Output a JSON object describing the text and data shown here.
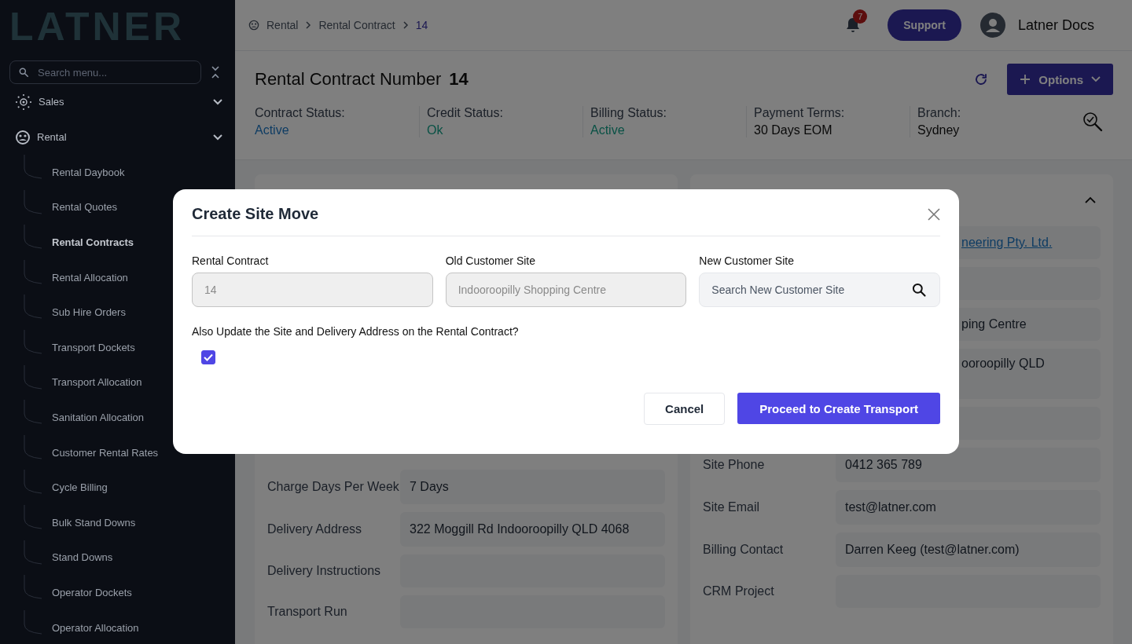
{
  "sidebar": {
    "logo": "LATNER",
    "search": {
      "placeholder": "Search menu..."
    },
    "items": [
      {
        "label": "Sales",
        "kind": "sales"
      },
      {
        "label": "Rental",
        "kind": "rental",
        "children": [
          {
            "label": "Rental Daybook",
            "selected": false
          },
          {
            "label": "Rental Quotes",
            "selected": false
          },
          {
            "label": "Rental Contracts",
            "selected": true
          },
          {
            "label": "Rental Allocation",
            "selected": false
          },
          {
            "label": "Sub Hire Orders",
            "selected": false
          },
          {
            "label": "Transport Dockets",
            "selected": false
          },
          {
            "label": "Transport Allocation",
            "selected": false
          },
          {
            "label": "Sanitation Allocation",
            "selected": false
          },
          {
            "label": "Customer Rental Rates",
            "selected": false
          },
          {
            "label": "Cycle Billing",
            "selected": false
          },
          {
            "label": "Bulk Stand Downs",
            "selected": false
          },
          {
            "label": "Stand Downs",
            "selected": false
          },
          {
            "label": "Operator Dockets",
            "selected": false
          },
          {
            "label": "Operator Allocation",
            "selected": false
          }
        ]
      }
    ]
  },
  "topbar": {
    "breadcrumb": [
      {
        "label": "Rental",
        "current": false
      },
      {
        "label": "Rental Contract",
        "current": false
      },
      {
        "label": "14",
        "current": true
      }
    ],
    "notifications": "7",
    "support": "Support",
    "user": "Latner Docs"
  },
  "header": {
    "title": "Rental Contract Number",
    "number": "14",
    "options": "Options",
    "statuses": [
      {
        "label": "Contract Status:",
        "value": "Active",
        "kind": "info"
      },
      {
        "label": "Credit Status:",
        "value": "Ok",
        "kind": "success"
      },
      {
        "label": "Billing Status:",
        "value": "Active",
        "kind": "success"
      },
      {
        "label": "Payment Terms:",
        "value": "30 Days EOM",
        "kind": "plain"
      },
      {
        "label": "Branch:",
        "value": "Sydney",
        "kind": "plain"
      }
    ]
  },
  "left_card": {
    "rows": [
      {
        "label": "Charge Days Per Week",
        "value": "7 Days"
      },
      {
        "label": "Delivery Address",
        "value": "322 Moggill Rd Indooroopilly QLD 4068"
      },
      {
        "label": "Delivery Instructions"
      },
      {
        "label": "Transport Run"
      }
    ]
  },
  "right_card": {
    "expanded": true,
    "rows": [
      {
        "value": "neering Pty. Ltd.",
        "kind": "link"
      },
      {
        "kind": "empty"
      },
      {
        "value": "ping Centre",
        "kind": "text"
      },
      {
        "value": "ooroopilly QLD",
        "kind": "tall"
      },
      {
        "kind": "empty"
      },
      {
        "label": "Site Phone",
        "value": "0412 365 789",
        "kind": "field"
      },
      {
        "label": "Site Email",
        "value": "test@latner.com",
        "kind": "field"
      },
      {
        "label": "Billing Contact",
        "value": "Darren Keeg (test@latner.com)",
        "kind": "field"
      },
      {
        "label": "CRM Project",
        "kind": "field"
      }
    ]
  },
  "modal": {
    "title": "Create Site Move",
    "fields": [
      {
        "label": "Rental Contract",
        "value": "14",
        "disabled": true,
        "kind": "text"
      },
      {
        "label": "Old Customer Site",
        "value": "Indooroopilly Shopping Centre",
        "disabled": true,
        "kind": "text"
      },
      {
        "label": "New Customer Site",
        "placeholder": "Search New Customer Site",
        "disabled": false,
        "kind": "search"
      }
    ],
    "question": "Also Update the Site and Delivery Address on the Rental Contract?",
    "checked": true,
    "cancel": "Cancel",
    "proceed": "Proceed to Create Transport"
  }
}
